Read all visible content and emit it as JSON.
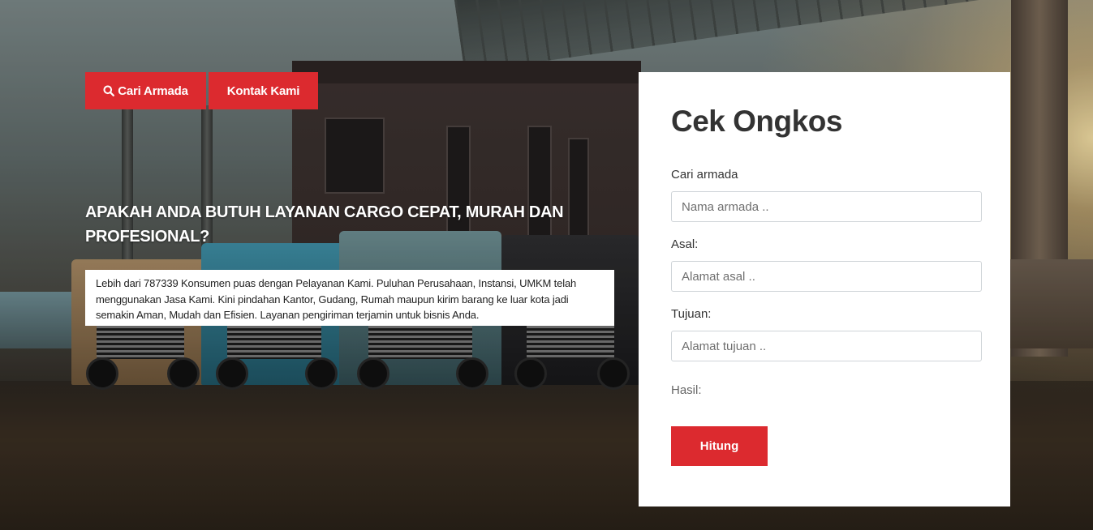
{
  "hero": {
    "buttons": {
      "cari_armada": {
        "label": "Cari Armada",
        "icon": "search-icon"
      },
      "kontak_kami": {
        "label": "Kontak Kami"
      }
    },
    "headline": "APAKAH ANDA BUTUH LAYANAN CARGO CEPAT, MURAH DAN PROFESIONAL?",
    "description": "Lebih dari 787339 Konsumen puas dengan Pelayanan Kami. Puluhan Perusahaan, Instansi, UMKM telah menggunakan Jasa Kami. Kini pindahan Kantor, Gudang, Rumah maupun kirim barang ke luar kota jadi semakin Aman, Mudah dan Efisien. Layanan pengiriman terjamin untuk bisnis Anda.",
    "background": "trucks-and-bridge-photo"
  },
  "form": {
    "title": "Cek Ongkos",
    "fields": {
      "armada": {
        "label": "Cari armada",
        "placeholder": "Nama armada ..",
        "value": ""
      },
      "asal": {
        "label": "Asal:",
        "placeholder": "Alamat asal ..",
        "value": ""
      },
      "tujuan": {
        "label": "Tujuan:",
        "placeholder": "Alamat tujuan ..",
        "value": ""
      }
    },
    "result_label": "Hasil:",
    "submit_label": "Hitung"
  },
  "colors": {
    "accent": "#dc2a2f",
    "card_bg": "#ffffff",
    "text_dark": "#333333"
  }
}
